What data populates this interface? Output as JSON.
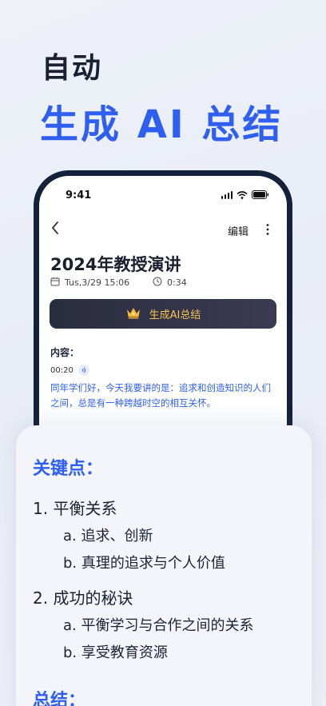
{
  "hero": {
    "line1": "自动",
    "line2": "生成 AI 总结"
  },
  "status_bar": {
    "time": "9:41"
  },
  "nav": {
    "edit_label": "编辑"
  },
  "note": {
    "title": "2024年教授演讲",
    "date": "Tus,3/29  15:06",
    "duration": "0:34",
    "generate_button_label": "生成AI总结",
    "content_label": "内容：",
    "timestamp": "00:20",
    "transcript": "同年学们好，今天我要讲的是：追求和创造知识的人们之间，总是有一种跨越时空的相互关怀。"
  },
  "summary_card": {
    "key_points_heading": "关键点：",
    "points": [
      {
        "label": "1.  平衡关系",
        "subs": [
          "a. 追求、创新",
          "b. 真理的追求与个人价值"
        ]
      },
      {
        "label": "2.  成功的秘诀",
        "subs": [
          "a. 平衡学习与合作之间的关系",
          "b. 享受教育资源"
        ]
      }
    ],
    "summary_heading": "总结："
  },
  "colors": {
    "accent_blue": "#2f5ff0",
    "phone_frame": "#14213a",
    "button_gold": "#f4c24f"
  },
  "icons": [
    "chevron-left-icon",
    "more-vertical-icon",
    "calendar-icon",
    "clock-icon",
    "crown-icon",
    "audio-wave-icon",
    "signal-icon",
    "wifi-icon",
    "battery-icon"
  ]
}
